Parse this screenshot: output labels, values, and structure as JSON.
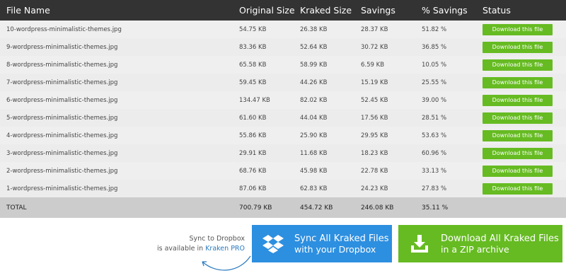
{
  "table": {
    "headers": [
      "File Name",
      "Original Size",
      "Kraked Size",
      "Savings",
      "% Savings",
      "Status"
    ],
    "rows": [
      {
        "name": "10-wordpress-minimalistic-themes.jpg",
        "original": "54.75 KB",
        "kraked": "26.38 KB",
        "savings": "28.37 KB",
        "pct": "51.82 %",
        "status": "Download this file"
      },
      {
        "name": "9-wordpress-minimalistic-themes.jpg",
        "original": "83.36 KB",
        "kraked": "52.64 KB",
        "savings": "30.72 KB",
        "pct": "36.85 %",
        "status": "Download this file"
      },
      {
        "name": "8-wordpress-minimalistic-themes.jpg",
        "original": "65.58 KB",
        "kraked": "58.99 KB",
        "savings": "6.59 KB",
        "pct": "10.05 %",
        "status": "Download this file"
      },
      {
        "name": "7-wordpress-minimalistic-themes.jpg",
        "original": "59.45 KB",
        "kraked": "44.26 KB",
        "savings": "15.19 KB",
        "pct": "25.55 %",
        "status": "Download this file"
      },
      {
        "name": "6-wordpress-minimalistic-themes.jpg",
        "original": "134.47 KB",
        "kraked": "82.02 KB",
        "savings": "52.45 KB",
        "pct": "39.00 %",
        "status": "Download this file"
      },
      {
        "name": "5-wordpress-minimalistic-themes.jpg",
        "original": "61.60 KB",
        "kraked": "44.04 KB",
        "savings": "17.56 KB",
        "pct": "28.51 %",
        "status": "Download this file"
      },
      {
        "name": "4-wordpress-minimalistic-themes.jpg",
        "original": "55.86 KB",
        "kraked": "25.90 KB",
        "savings": "29.95 KB",
        "pct": "53.63 %",
        "status": "Download this file"
      },
      {
        "name": "3-wordpress-minimalistic-themes.jpg",
        "original": "29.91 KB",
        "kraked": "11.68 KB",
        "savings": "18.23 KB",
        "pct": "60.96 %",
        "status": "Download this file"
      },
      {
        "name": "2-wordpress-minimalistic-themes.jpg",
        "original": "68.76 KB",
        "kraked": "45.98 KB",
        "savings": "22.78 KB",
        "pct": "33.13 %",
        "status": "Download this file"
      },
      {
        "name": "1-wordpress-minimalistic-themes.jpg",
        "original": "87.06 KB",
        "kraked": "62.83 KB",
        "savings": "24.23 KB",
        "pct": "27.83 %",
        "status": "Download this file"
      }
    ],
    "total": {
      "label": "TOTAL",
      "original": "700.79 KB",
      "kraked": "454.72 KB",
      "savings": "246.08 KB",
      "pct": "35.11 %"
    }
  },
  "promo": {
    "line1": "Sync to Dropbox",
    "line2_prefix": "is available in",
    "link": "Kraken PRO"
  },
  "dropbox_button": {
    "line1": "Sync All Kraked Files",
    "line2": "with your Dropbox",
    "icon": "dropbox-icon"
  },
  "zip_button": {
    "line1": "Download All Kraked Files",
    "line2": "in a ZIP archive",
    "icon": "download-tray-icon"
  },
  "colors": {
    "header_bg": "#333333",
    "green": "#66bb22",
    "blue": "#2d8fe0",
    "link": "#2a7abf",
    "total_bg": "#cccccc"
  }
}
